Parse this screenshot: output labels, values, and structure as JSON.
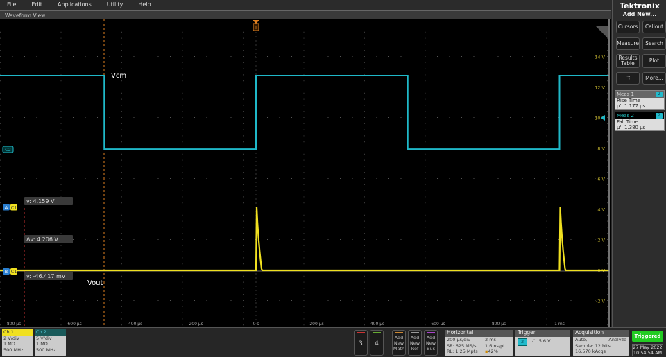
{
  "menu": [
    "File",
    "Edit",
    "Applications",
    "Utility",
    "Help"
  ],
  "waveform_view": {
    "title": "Waveform View"
  },
  "brand": "Tektronix",
  "side_panel": {
    "add_new": "Add New...",
    "buttons": [
      "Cursors",
      "Callout",
      "Measure",
      "Search",
      "Results Table",
      "Plot",
      "",
      "More..."
    ],
    "measurements": [
      {
        "title": "Meas 1",
        "channel": "2",
        "name": "Rise Time",
        "value": "µ': 1.177 µs"
      },
      {
        "title": "Meas 2",
        "channel": "2",
        "name": "Fall Time",
        "value": "µ': 1.380 µs"
      }
    ]
  },
  "plot": {
    "time_ticks": [
      {
        "t": -800,
        "label": "-800 µs"
      },
      {
        "t": -600,
        "label": "-600 µs"
      },
      {
        "t": -400,
        "label": "-400 µs"
      },
      {
        "t": -200,
        "label": "-200 µs"
      },
      {
        "t": 0,
        "label": "0 s"
      },
      {
        "t": 200,
        "label": "200 µs"
      },
      {
        "t": 400,
        "label": "400 µs"
      },
      {
        "t": 600,
        "label": "600 µs"
      },
      {
        "t": 800,
        "label": "800 µs"
      },
      {
        "t": 1000,
        "label": "1 ms"
      }
    ],
    "volt_ticks": [
      {
        "v": 14,
        "label": "14 V"
      },
      {
        "v": 12,
        "label": "12 V"
      },
      {
        "v": 10,
        "label": "10 V"
      },
      {
        "v": 8,
        "label": "8 V"
      },
      {
        "v": 6,
        "label": "6 V"
      },
      {
        "v": 4,
        "label": "4 V"
      },
      {
        "v": 2,
        "label": "2 V"
      },
      {
        "v": 0,
        "label": "0 V"
      },
      {
        "v": -2,
        "label": "-2 V"
      }
    ],
    "ch2_label": "Vcm",
    "ch1_label": "Vout",
    "ch2_badge": "C2",
    "cursor_a": {
      "badge": "A",
      "ch": "C1",
      "readout": "v: 4.159 V",
      "v": 4.159
    },
    "cursor_b": {
      "badge": "B",
      "ch": "C1",
      "readout": "v: -46.417 mV",
      "v": -0.046
    },
    "delta_readout": "Δv: 4.206 V",
    "trigger_marker": "T",
    "colors": {
      "ch1": "#f0e020",
      "ch2": "#1fb8c8",
      "cursor": "#e08020",
      "cursor2": "#c03030"
    },
    "ch2_edges_us": [
      -500,
      0,
      500,
      1000
    ],
    "ch2_high_v": 12.6,
    "ch2_low_v": 7.8,
    "ch1_pulses_us": [
      0,
      1000
    ],
    "ch1_peak_v": 4.16,
    "ch1_base_v": 0
  },
  "bottom": {
    "ch1": {
      "title": "Ch 1",
      "lines": [
        "2 V/div",
        "1 MΩ",
        "500 MHz"
      ]
    },
    "ch2": {
      "title": "Ch 2",
      "lines": [
        "5 V/div",
        "1 MΩ",
        "500 MHz"
      ]
    },
    "ch3": "3",
    "ch4": "4",
    "add_math": [
      "Add",
      "New",
      "Math"
    ],
    "add_ref": [
      "Add",
      "New",
      "Ref"
    ],
    "add_bus": [
      "Add",
      "New",
      "Bus"
    ],
    "horizontal": {
      "title": "Horizontal",
      "rows": [
        [
          "200 µs/div",
          "2 ms"
        ],
        [
          "SR: 625 MS/s",
          "1.6 ns/pt"
        ],
        [
          "RL: 1.25 Mpts",
          "42%"
        ]
      ]
    },
    "trigger": {
      "title": "Trigger",
      "source": "2",
      "level": "5.6 V"
    },
    "acquisition": {
      "title": "Acquisition",
      "rows": [
        [
          "Auto,",
          "Analyze"
        ],
        [
          "Sample: 12 bits",
          ""
        ],
        [
          "16.570 kAcqs",
          ""
        ]
      ]
    },
    "status": "Triggered",
    "date": "27 May 2022",
    "time": "10:54:54 AM"
  }
}
